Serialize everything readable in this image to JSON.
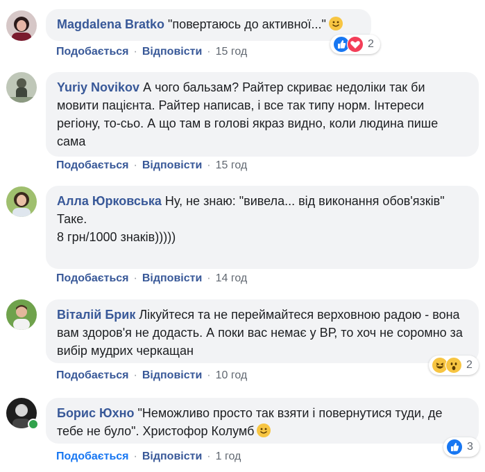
{
  "comments": [
    {
      "author": "Magdalena Bratko",
      "text": "\"повертаюсь до активної...\"",
      "like_label": "Подобається",
      "reply_label": "Відповісти",
      "time": "15 год",
      "reactions": {
        "icons": [
          "like-icon",
          "love-icon"
        ],
        "count": "2"
      }
    },
    {
      "author": "Yuriy Novikov",
      "text": "А чого бальзам? Райтер скриває недоліки так би мовити пацієнта. Райтер написав, і все так типу норм. Інтереси регіону, то-сьо. А що там в голові якраз видно, коли людина пише сама",
      "like_label": "Подобається",
      "reply_label": "Відповісти",
      "time": "15 год"
    },
    {
      "author": "Алла Юрковська",
      "text": "Ну, не знаю: \"вивела... від виконання обов'язків\"\nТаке.\n8 грн/1000 знаків)))))",
      "like_label": "Подобається",
      "reply_label": "Відповісти",
      "time": "14 год"
    },
    {
      "author": "Віталій Брик",
      "text": "Лікуйтеся та не переймайтеся верховною радою - вона вам здоров'я не додасть. А поки вас немає у ВР, то хоч не соромно за вибір мудрих черкащан",
      "like_label": "Подобається",
      "reply_label": "Відповісти",
      "time": "10 год",
      "reactions": {
        "icons": [
          "haha-icon",
          "wow-icon"
        ],
        "count": "2"
      }
    },
    {
      "author": "Борис Юхно",
      "text": "\"Неможливо просто так взяти і повернутися туди, де тебе не було\". Христофор Колумб",
      "like_label": "Подобається",
      "reply_label": "Відповісти",
      "time": "1 год",
      "reactions": {
        "icons": [
          "like-icon"
        ],
        "count": "3"
      }
    }
  ],
  "separator": "·",
  "colors": {
    "author": "#385898",
    "bubble": "#f2f3f5",
    "meta": "#606770",
    "online": "#31a24c"
  }
}
